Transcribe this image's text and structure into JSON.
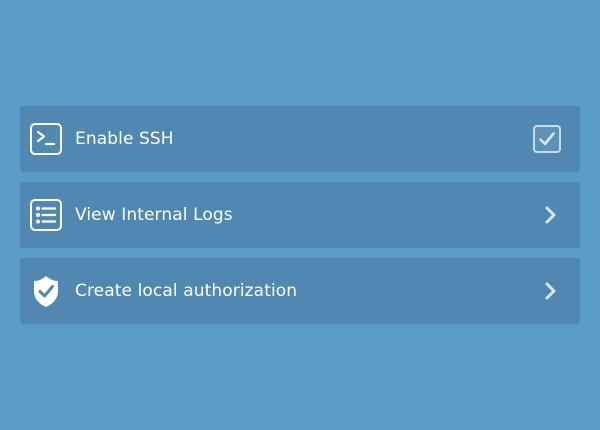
{
  "items": [
    {
      "label": "Enable SSH",
      "icon": "terminal-icon",
      "control": "checkbox",
      "checked": true
    },
    {
      "label": "View Internal Logs",
      "icon": "list-icon",
      "control": "chevron-right-icon"
    },
    {
      "label": "Create local authorization",
      "icon": "shield-check-icon",
      "control": "chevron-right-icon"
    }
  ],
  "colors": {
    "background": "#5a9bc8",
    "row": "#5088b1",
    "text": "#ffffff",
    "checkbox_border": "#c9d9e6"
  }
}
